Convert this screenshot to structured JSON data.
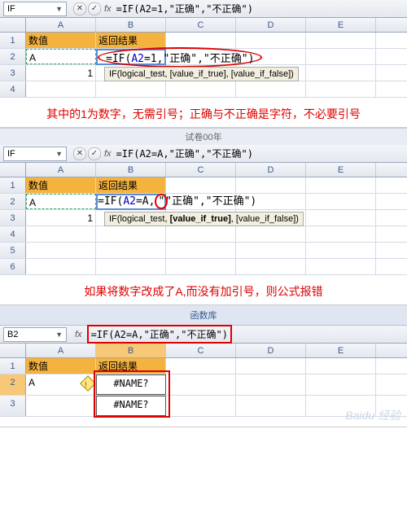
{
  "columns": [
    "A",
    "B",
    "C",
    "D",
    "E"
  ],
  "panel1": {
    "name_box": "IF",
    "formula_bar": "=IF(A2=1,\"正确\",\"不正确\")",
    "headers": {
      "A": "数值",
      "B": "返回结果"
    },
    "r2_A": "A",
    "r2_B_formula": "=IF(A2=1,\"正确\",\"不正确\")",
    "r3_A": "1",
    "tooltip": "IF(logical_test, [value_if_true], [value_if_false])",
    "annotation": "其中的1为数字，无需引号；正确与不正确是字符，不必要引号"
  },
  "tab_mid": "试卷00年",
  "panel2": {
    "name_box": "IF",
    "formula_bar": "=IF(A2=A,\"正确\",\"不正确\")",
    "headers": {
      "A": "数值",
      "B": "返回结果"
    },
    "r2_A": "A",
    "r2_B_left": "=IF(A2=A,",
    "r2_B_right": "\"正确\",\"不正确\")",
    "r3_A": "1",
    "tooltip_parts": {
      "a": "IF(logical_test, ",
      "b": "[value_if_true]",
      "c": ", [value_if_false])"
    },
    "annotation": "如果将数字改成了A,而没有加引号，则公式报错"
  },
  "panel3": {
    "ribbon_label": "函数库",
    "name_box": "B2",
    "formula_bar": "=IF(A2=A,\"正确\",\"不正确\")",
    "headers": {
      "A": "数值",
      "B": "返回结果"
    },
    "r2_A": "A",
    "r2_B": "#NAME?",
    "r3_B": "#NAME?"
  },
  "watermark": "Baidu 经验"
}
